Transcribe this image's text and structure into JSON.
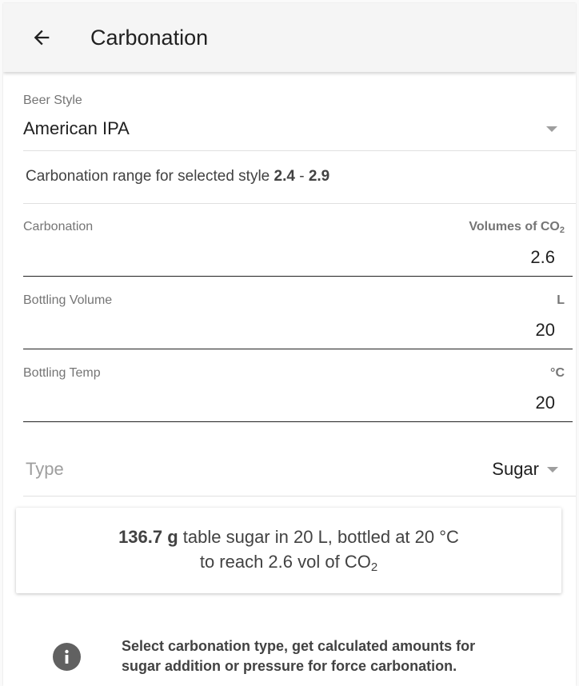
{
  "appbar": {
    "title": "Carbonation",
    "back_icon": "arrow-left-icon"
  },
  "beer_style": {
    "label": "Beer Style",
    "value": "American IPA"
  },
  "range": {
    "prefix": "Carbonation range for selected style ",
    "min": "2.4",
    "separator": " - ",
    "max": "2.9"
  },
  "carbonation": {
    "label": "Carbonation",
    "unit_prefix": "Volumes of CO",
    "unit_sub": "2",
    "value": "2.6"
  },
  "bottling_volume": {
    "label": "Bottling Volume",
    "unit": "L",
    "value": "20"
  },
  "bottling_temp": {
    "label": "Bottling Temp",
    "unit": "°C",
    "value": "20"
  },
  "type": {
    "label": "Type",
    "value": "Sugar"
  },
  "result": {
    "amount": "136.7 g",
    "line1_rest": " table sugar in 20 L, bottled at 20 °C",
    "line2_prefix": "to reach 2.6 vol of CO",
    "line2_sub": "2"
  },
  "info": {
    "icon": "info-icon",
    "line1": "Select carbonation type, get calculated amounts for",
    "line2": "sugar addition or pressure for force carbonation."
  },
  "colors": {
    "appbar_bg": "#f5f5f5",
    "text_primary": "#212121",
    "text_secondary": "#757575",
    "icon_grey": "#616161"
  }
}
